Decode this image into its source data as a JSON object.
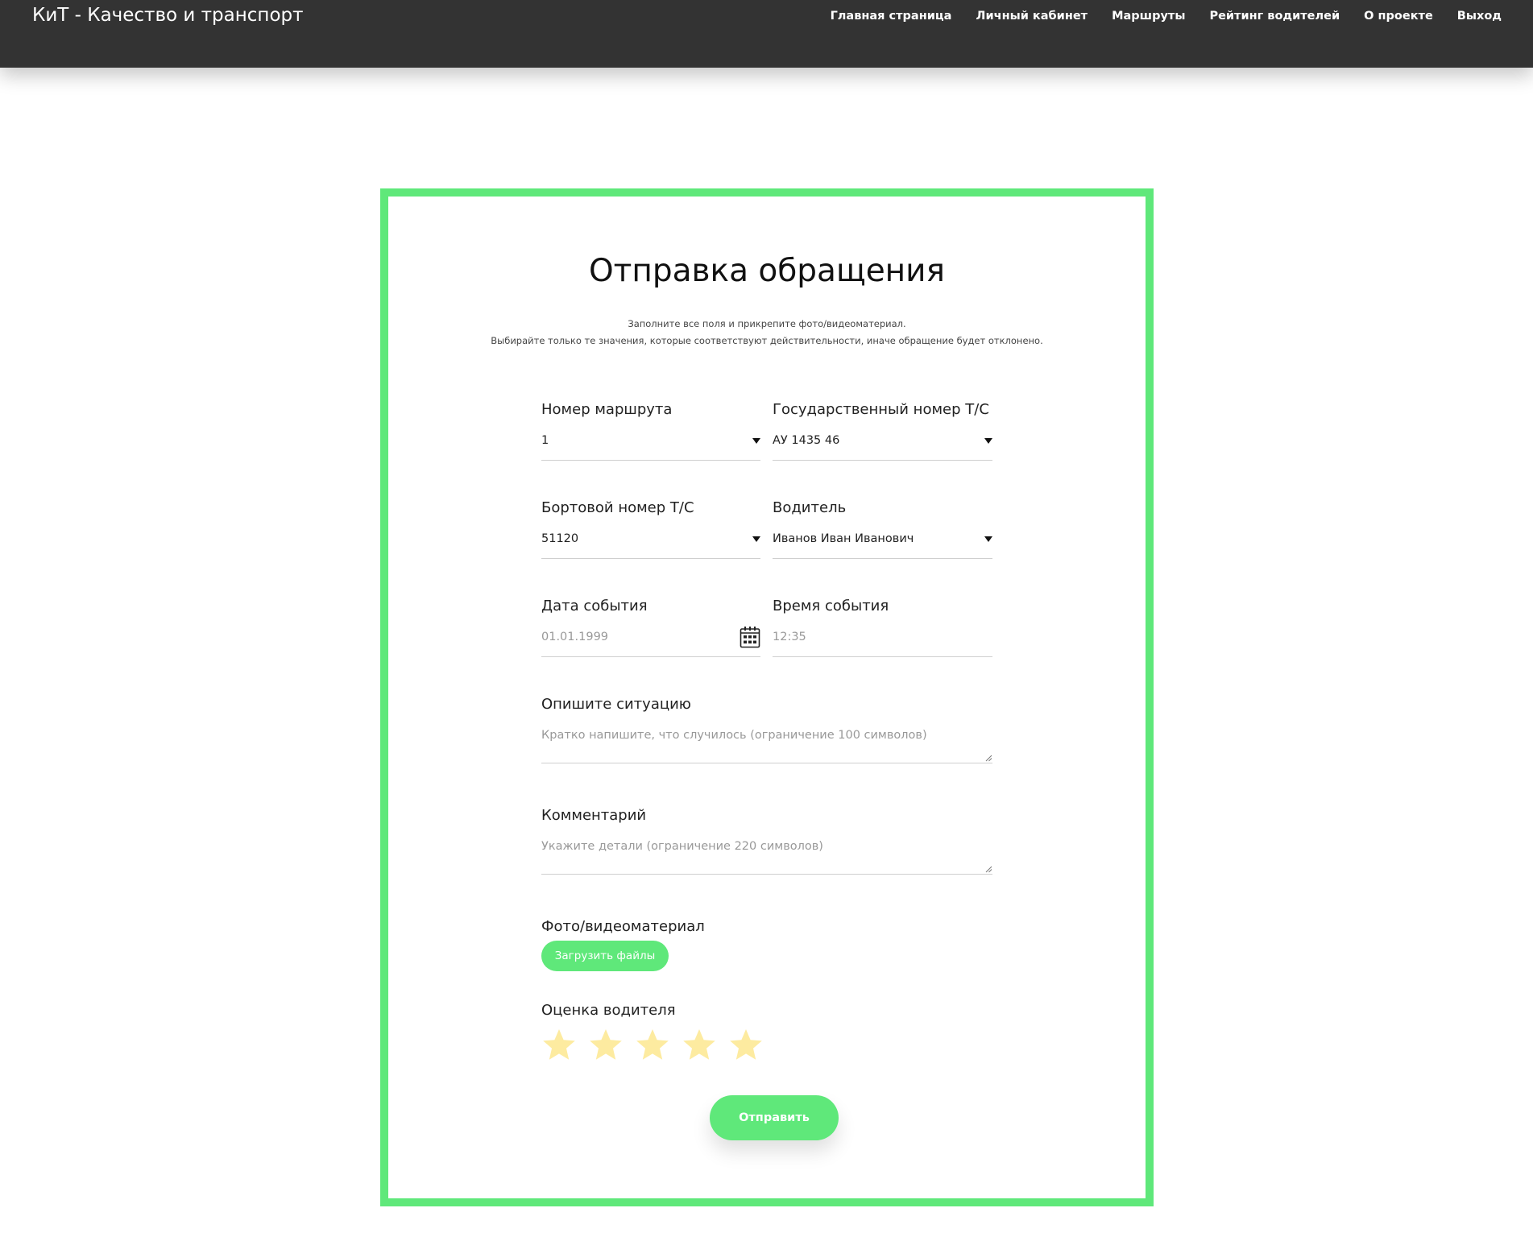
{
  "header": {
    "brand": "КиТ - Качество и транспорт",
    "nav": [
      "Главная страница",
      "Личный кабинет",
      "Маршруты",
      "Рейтинг водителей",
      "О проекте",
      "Выход"
    ]
  },
  "form": {
    "title": "Отправка обращения",
    "subtitle_line1": "Заполните все поля и прикрепите фото/видеоматериал.",
    "subtitle_line2": "Выбирайте только те значения, которые соответствуют действительности, иначе обращение будет отклонено.",
    "route": {
      "label": "Номер маршрута",
      "value": "1"
    },
    "plate": {
      "label": "Государственный номер Т/С",
      "value": "АУ 1435 46"
    },
    "board": {
      "label": "Бортовой номер Т/С",
      "value": "51120"
    },
    "driver": {
      "label": "Водитель",
      "value": "Иванов Иван Иванович"
    },
    "date": {
      "label": "Дата события",
      "placeholder": "01.01.1999"
    },
    "time": {
      "label": "Время события",
      "placeholder": "12:35"
    },
    "situation": {
      "label": "Опишите ситуацию",
      "placeholder": "Кратко напишите, что случилось (ограничение 100 символов)"
    },
    "comment": {
      "label": "Комментарий",
      "placeholder": "Укажите детали (ограничение 220 символов)"
    },
    "media": {
      "label": "Фото/видеоматериал",
      "button": "Загрузить файлы"
    },
    "rating": {
      "label": "Оценка водителя",
      "stars_total": 5,
      "stars_filled": 0
    },
    "submit": "Отправить"
  },
  "colors": {
    "accent": "#5fe87a",
    "header_bg": "#333333",
    "star": "#fdeba0"
  }
}
